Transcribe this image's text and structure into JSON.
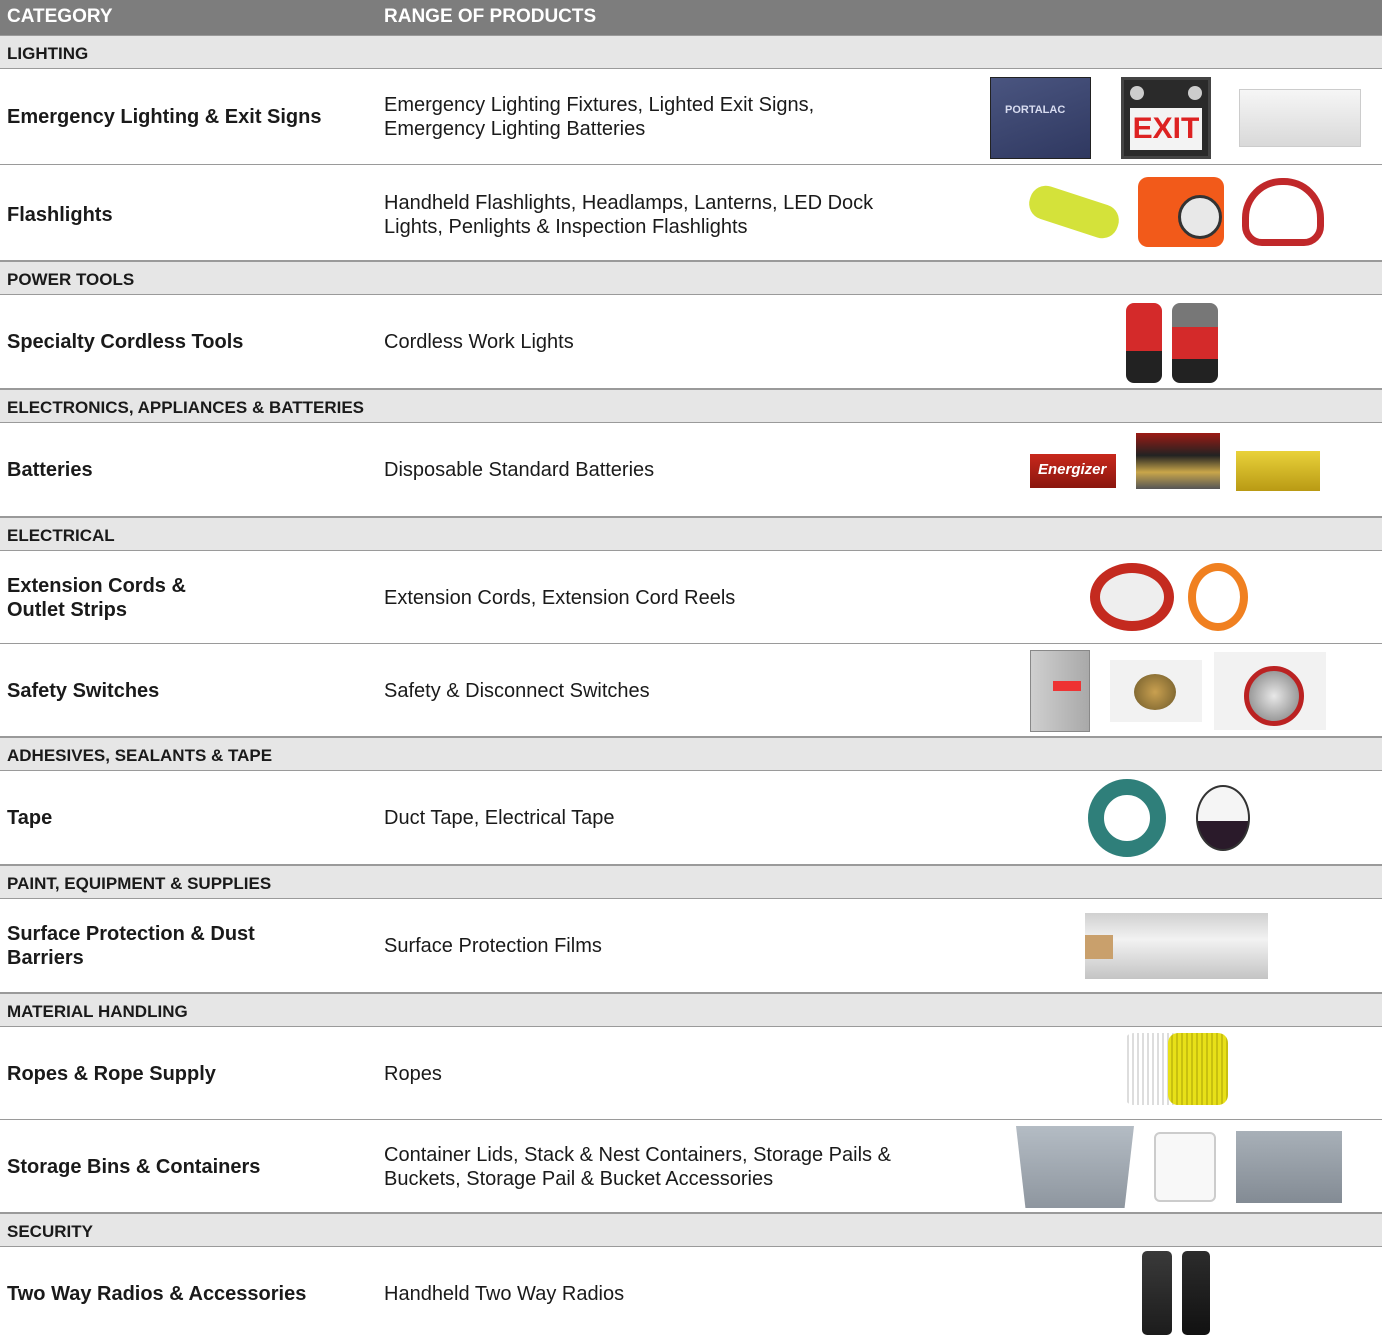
{
  "header": {
    "category": "CATEGORY",
    "range": "RANGE OF PRODUCTS"
  },
  "sections": {
    "lighting": "LIGHTING",
    "power_tools": "POWER TOOLS",
    "electronics": "ELECTRONICS, APPLIANCES & BATTERIES",
    "electrical": "ELECTRICAL",
    "adhesives": "ADHESIVES, SEALANTS & TAPE",
    "paint": "PAINT, EQUIPMENT & SUPPLIES",
    "material": "MATERIAL HANDLING",
    "security": "SECURITY"
  },
  "rows": {
    "emergency": {
      "category": "Emergency Lighting & Exit Signs",
      "products": "Emergency Lighting Fixtures, Lighted Exit Signs, Emergency Lighting Batteries"
    },
    "flashlights": {
      "category": "Flashlights",
      "products": "Handheld Flashlights, Headlamps, Lanterns, LED Dock Lights, Penlights & Inspection Flashlights"
    },
    "cordless": {
      "category": "Specialty Cordless Tools",
      "products": "Cordless Work Lights"
    },
    "batteries": {
      "category": "Batteries",
      "products": "Disposable Standard Batteries"
    },
    "extension": {
      "category": "Extension Cords & Outlet Strips",
      "products": "Extension Cords, Extension Cord Reels"
    },
    "safety": {
      "category": "Safety Switches",
      "products": "Safety & Disconnect Switches"
    },
    "tape": {
      "category": "Tape",
      "products": "Duct Tape, Electrical Tape"
    },
    "surface": {
      "category": "Surface Protection & Dust Barriers",
      "products": "Surface Protection Films"
    },
    "ropes": {
      "category": "Ropes & Rope Supply",
      "products": "Ropes"
    },
    "storage": {
      "category": "Storage Bins & Containers",
      "products": "Container Lids, Stack & Nest Containers, Storage Pails & Buckets, Storage Pail & Bucket Accessories"
    },
    "radios": {
      "category": "Two Way Radios & Accessories",
      "products": "Handheld Two Way Radios"
    }
  },
  "image_text": {
    "exit": "EXIT",
    "energizer": "Energizer",
    "portalac": "PORTALAC"
  },
  "colors": {
    "header_bg": "#7d7d7d",
    "section_bg": "#e6e6e6",
    "rule": "#9a9a9a"
  }
}
